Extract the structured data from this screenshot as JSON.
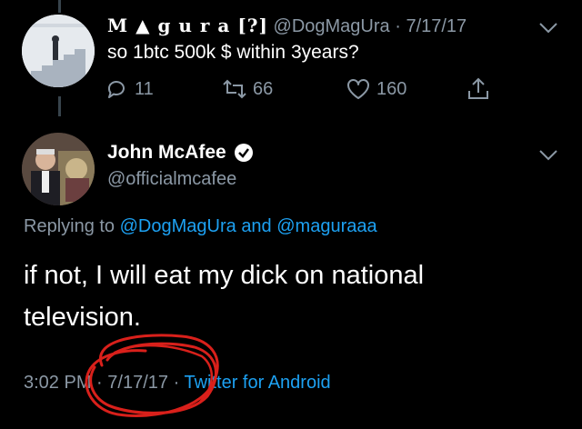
{
  "reply_context": {
    "display_name": "M ▲ g u r a [?]",
    "handle": "@DogMagUra",
    "sep": "·",
    "date": "7/17/17",
    "text": "so 1btc 500k $ within 3years?",
    "actions": {
      "replies": "11",
      "retweets": "66",
      "likes": "160"
    }
  },
  "main_tweet": {
    "display_name": "John McAfee",
    "handle": "@officialmcafee",
    "replying_prefix": "Replying to",
    "replying_user1": "@DogMagUra",
    "replying_and": "and",
    "replying_user2": "@maguraaa",
    "text_line1": "if not, I will eat my dick on national",
    "text_line2": "television.",
    "time": "3:02 PM",
    "dot1": "·",
    "date": "7/17/17",
    "dot2": "·",
    "source": "Twitter for Android"
  },
  "icons": {
    "verified": "verified-badge-icon",
    "reply": "reply-icon",
    "retweet": "retweet-icon",
    "like": "heart-icon",
    "share": "share-icon",
    "chevron": "chevron-down-icon"
  },
  "colors": {
    "link": "#1da1f2",
    "muted": "#8b98a5",
    "annotation": "#d9201b"
  }
}
